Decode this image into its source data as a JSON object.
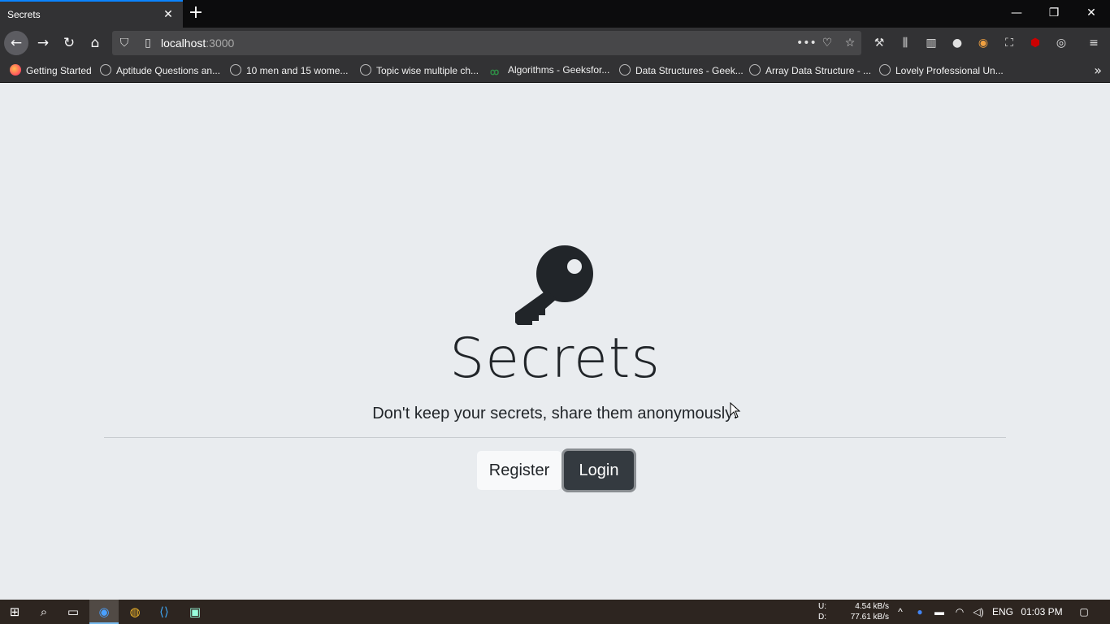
{
  "browser": {
    "tab_title": "Secrets",
    "url_host": "localhost",
    "url_port": ":3000",
    "page_actions": "•••",
    "bookmarks": [
      {
        "label": "Getting Started",
        "icon": "firefox-icon"
      },
      {
        "label": "Aptitude Questions an...",
        "icon": "globe-icon"
      },
      {
        "label": "10 men and 15 wome...",
        "icon": "globe-icon"
      },
      {
        "label": "Topic wise multiple ch...",
        "icon": "globe-icon"
      },
      {
        "label": "Algorithms - Geeksfor...",
        "icon": "gfg-icon"
      },
      {
        "label": "Data Structures - Geek...",
        "icon": "globe-icon"
      },
      {
        "label": "Array Data Structure - ...",
        "icon": "globe-icon"
      },
      {
        "label": "Lovely Professional Un...",
        "icon": "globe-icon"
      }
    ]
  },
  "page": {
    "title": "Secrets",
    "lead": "Don't keep your secrets, share them anonymously!",
    "register_label": "Register",
    "login_label": "Login",
    "icon": "key-icon",
    "text_color": "#212529",
    "background": "#e9ecef"
  },
  "taskbar": {
    "upload_label": "U:",
    "download_label": "D:",
    "upload_speed": "4.54 kB/s",
    "download_speed": "77.61 kB/s",
    "language": "ENG",
    "time": "01:03 PM"
  }
}
